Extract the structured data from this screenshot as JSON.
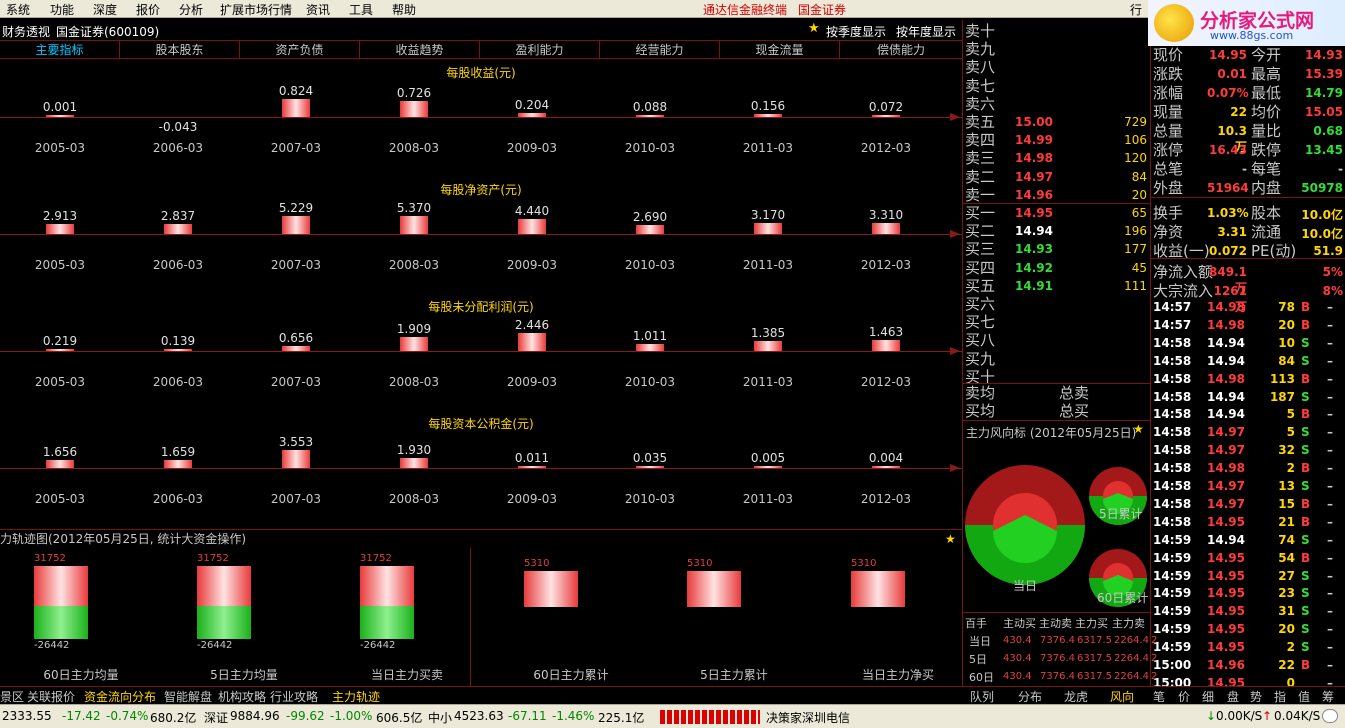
{
  "menubar": {
    "items": [
      "系统",
      "功能",
      "深度",
      "报价",
      "分析",
      "扩展市场行情",
      "资讯",
      "工具",
      "帮助"
    ],
    "links": [
      "通达信金融终端",
      "国金证券"
    ],
    "right_item": "行"
  },
  "watermark": {
    "line1": "分析家公式网",
    "line2": "www.88gs.com"
  },
  "titlebar": {
    "title": "财务透视",
    "stock": "国金证券(600109)",
    "opt_season": "按季度显示",
    "opt_year": "按年度显示"
  },
  "tabs": [
    "主要指标",
    "股本股东",
    "资产负债",
    "收益趋势",
    "盈利能力",
    "经营能力",
    "现金流量",
    "偿债能力"
  ],
  "years": [
    "2005-03",
    "2006-03",
    "2007-03",
    "2008-03",
    "2009-03",
    "2010-03",
    "2011-03",
    "2012-03"
  ],
  "sections": [
    {
      "title": "每股收益(元)",
      "values": [
        "0.001",
        "-0.043",
        "0.824",
        "0.726",
        "0.204",
        "0.088",
        "0.156",
        "0.072"
      ]
    },
    {
      "title": "每股净资产(元)",
      "values": [
        "2.913",
        "2.837",
        "5.229",
        "5.370",
        "4.440",
        "2.690",
        "3.170",
        "3.310"
      ]
    },
    {
      "title": "每股未分配利润(元)",
      "values": [
        "0.219",
        "0.139",
        "0.656",
        "1.909",
        "2.446",
        "1.011",
        "1.385",
        "1.463"
      ]
    },
    {
      "title": "每股资本公积金(元)",
      "values": [
        "1.656",
        "1.659",
        "3.553",
        "1.930",
        "0.011",
        "0.035",
        "0.005",
        "0.004"
      ]
    }
  ],
  "flow": {
    "title": "力轨迹图(2012年05月25日, 统计大资金操作)",
    "groups": [
      {
        "caption": "60日主力均量",
        "pos": "31752",
        "neg": "-26442",
        "pos_val": 31752,
        "neg_val": 26442
      },
      {
        "caption": "5日主力均量",
        "pos": "31752",
        "neg": "-26442",
        "pos_val": 31752,
        "neg_val": 26442
      },
      {
        "caption": "当日主力买卖",
        "pos": "31752",
        "neg": "-26442",
        "pos_val": 31752,
        "neg_val": 26442
      },
      {
        "caption": "60日主力累计",
        "pos": "5310",
        "neg": "",
        "pos_val": 5310,
        "neg_val": 0
      },
      {
        "caption": "5日主力累计",
        "pos": "5310",
        "neg": "",
        "pos_val": 5310,
        "neg_val": 0
      },
      {
        "caption": "当日主力净买",
        "pos": "5310",
        "neg": "",
        "pos_val": 5310,
        "neg_val": 0
      }
    ]
  },
  "orderbook": {
    "sell": [
      {
        "label": "卖十",
        "price": "",
        "vol": ""
      },
      {
        "label": "卖九",
        "price": "",
        "vol": ""
      },
      {
        "label": "卖八",
        "price": "",
        "vol": ""
      },
      {
        "label": "卖七",
        "price": "",
        "vol": ""
      },
      {
        "label": "卖六",
        "price": "",
        "vol": ""
      },
      {
        "label": "卖五",
        "price": "15.00",
        "vol": "729"
      },
      {
        "label": "卖四",
        "price": "14.99",
        "vol": "106"
      },
      {
        "label": "卖三",
        "price": "14.98",
        "vol": "120"
      },
      {
        "label": "卖二",
        "price": "14.97",
        "vol": "84"
      },
      {
        "label": "卖一",
        "price": "14.96",
        "vol": "20"
      }
    ],
    "buy": [
      {
        "label": "买一",
        "price": "14.95",
        "vol": "65",
        "color": "#ff3b3b"
      },
      {
        "label": "买二",
        "price": "14.94",
        "vol": "196",
        "color": "#ffffff"
      },
      {
        "label": "买三",
        "price": "14.93",
        "vol": "177",
        "color": "#33dd33"
      },
      {
        "label": "买四",
        "price": "14.92",
        "vol": "45",
        "color": "#33dd33"
      },
      {
        "label": "买五",
        "price": "14.91",
        "vol": "111",
        "color": "#33dd33"
      },
      {
        "label": "买六",
        "price": "",
        "vol": ""
      },
      {
        "label": "买七",
        "price": "",
        "vol": ""
      },
      {
        "label": "买八",
        "price": "",
        "vol": ""
      },
      {
        "label": "买九",
        "price": "",
        "vol": ""
      },
      {
        "label": "买十",
        "price": "",
        "vol": ""
      }
    ],
    "avg_sell": "卖均",
    "avg_buy": "买均",
    "total_sell": "总卖",
    "total_buy": "总买"
  },
  "quote": {
    "rows": [
      {
        "l1": "现价",
        "v1": "14.95",
        "c1": "#ff3b3b",
        "l2": "今开",
        "v2": "14.93",
        "c2": "#ff3b3b"
      },
      {
        "l1": "涨跌",
        "v1": "0.01",
        "c1": "#ff3b3b",
        "l2": "最高",
        "v2": "15.39",
        "c2": "#ff3b3b"
      },
      {
        "l1": "涨幅",
        "v1": "0.07%",
        "c1": "#ff3b3b",
        "l2": "最低",
        "v2": "14.79",
        "c2": "#33dd33"
      },
      {
        "l1": "现量",
        "v1": "22",
        "c1": "#ffd700",
        "l2": "均价",
        "v2": "15.05",
        "c2": "#ff3b3b"
      },
      {
        "l1": "总量",
        "v1": "10.3万",
        "c1": "#ffd700",
        "l2": "量比",
        "v2": "0.68",
        "c2": "#33dd33"
      },
      {
        "l1": "涨停",
        "v1": "16.43",
        "c1": "#ff3b3b",
        "l2": "跌停",
        "v2": "13.45",
        "c2": "#33dd33"
      },
      {
        "l1": "总笔",
        "v1": "-",
        "c1": "#c8c8c8",
        "l2": "每笔",
        "v2": "-",
        "c2": "#c8c8c8"
      },
      {
        "l1": "外盘",
        "v1": "51964",
        "c1": "#ff3b3b",
        "l2": "内盘",
        "v2": "50978",
        "c2": "#33dd33"
      },
      {
        "l1": "换手",
        "v1": "1.03%",
        "c1": "#ffd700",
        "l2": "股本",
        "v2": "10.0亿",
        "c2": "#ffd700"
      },
      {
        "l1": "净资",
        "v1": "3.31",
        "c1": "#ffd700",
        "l2": "流通",
        "v2": "10.0亿",
        "c2": "#ffd700"
      },
      {
        "l1": "收益(一)",
        "v1": "0.072",
        "c1": "#ffd700",
        "l2": "PE(动)",
        "v2": "51.9",
        "c2": "#ffd700"
      },
      {
        "l1": "净流入额",
        "v1": "849.1万",
        "c1": "#ff3b3b",
        "l2": "",
        "v2": "5%",
        "c2": "#ff3b3b"
      },
      {
        "l1": "大宗流入",
        "v1": "1261万",
        "c1": "#ff3b3b",
        "l2": "",
        "v2": "8%",
        "c2": "#ff3b3b"
      }
    ]
  },
  "ticks": [
    {
      "t": "14:57",
      "p": "14.98",
      "pc": "#ff3b3b",
      "v": "78",
      "s": "B"
    },
    {
      "t": "14:57",
      "p": "14.98",
      "pc": "#ff3b3b",
      "v": "20",
      "s": "B"
    },
    {
      "t": "14:58",
      "p": "14.94",
      "pc": "#ffffff",
      "v": "10",
      "s": "S"
    },
    {
      "t": "14:58",
      "p": "14.94",
      "pc": "#ffffff",
      "v": "84",
      "s": "S"
    },
    {
      "t": "14:58",
      "p": "14.98",
      "pc": "#ff3b3b",
      "v": "113",
      "s": "B"
    },
    {
      "t": "14:58",
      "p": "14.94",
      "pc": "#ffffff",
      "v": "187",
      "s": "S"
    },
    {
      "t": "14:58",
      "p": "14.94",
      "pc": "#ffffff",
      "v": "5",
      "s": "B"
    },
    {
      "t": "14:58",
      "p": "14.97",
      "pc": "#ff3b3b",
      "v": "5",
      "s": "S"
    },
    {
      "t": "14:58",
      "p": "14.97",
      "pc": "#ff3b3b",
      "v": "32",
      "s": "S"
    },
    {
      "t": "14:58",
      "p": "14.98",
      "pc": "#ff3b3b",
      "v": "2",
      "s": "B"
    },
    {
      "t": "14:58",
      "p": "14.97",
      "pc": "#ff3b3b",
      "v": "13",
      "s": "S"
    },
    {
      "t": "14:58",
      "p": "14.97",
      "pc": "#ff3b3b",
      "v": "15",
      "s": "B"
    },
    {
      "t": "14:58",
      "p": "14.95",
      "pc": "#ff3b3b",
      "v": "21",
      "s": "B"
    },
    {
      "t": "14:59",
      "p": "14.94",
      "pc": "#ffffff",
      "v": "74",
      "s": "S"
    },
    {
      "t": "14:59",
      "p": "14.95",
      "pc": "#ff3b3b",
      "v": "54",
      "s": "B"
    },
    {
      "t": "14:59",
      "p": "14.95",
      "pc": "#ff3b3b",
      "v": "27",
      "s": "S"
    },
    {
      "t": "14:59",
      "p": "14.95",
      "pc": "#ff3b3b",
      "v": "23",
      "s": "S"
    },
    {
      "t": "14:59",
      "p": "14.95",
      "pc": "#ff3b3b",
      "v": "31",
      "s": "S"
    },
    {
      "t": "14:59",
      "p": "14.95",
      "pc": "#ff3b3b",
      "v": "20",
      "s": "S"
    },
    {
      "t": "14:59",
      "p": "14.95",
      "pc": "#ff3b3b",
      "v": "2",
      "s": "S"
    },
    {
      "t": "15:00",
      "p": "14.96",
      "pc": "#ff3b3b",
      "v": "22",
      "s": "B"
    },
    {
      "t": "15:00",
      "p": "14.95",
      "pc": "#ff3b3b",
      "v": "0",
      "s": ""
    }
  ],
  "zl": {
    "title": "主力风向标 (2012年05月25日)",
    "today": "当日",
    "d5": "5日累计",
    "d60": "60日累计",
    "table_head": [
      "百手",
      "主动买",
      "主动卖",
      "主力买",
      "主力卖"
    ],
    "rows": [
      {
        "label": "当日",
        "vals": [
          "430.4",
          "7376.4",
          "6317.5",
          "2264.4",
          "2"
        ]
      },
      {
        "label": "5日",
        "vals": [
          "430.4",
          "7376.4",
          "6317.5",
          "2264.4",
          "2"
        ]
      },
      {
        "label": "60日",
        "vals": [
          "430.4",
          "7376.4",
          "6317.5",
          "2264.4",
          "2"
        ]
      }
    ]
  },
  "bottomtabs": {
    "left": [
      "景区",
      "关联报价",
      "资金流向分布",
      "智能解盘",
      "机构攻略",
      "行业攻略",
      "主力轨迹"
    ],
    "right": [
      "队列",
      "分布",
      "龙虎",
      "风向",
      "笔",
      "价",
      "细",
      "盘",
      "势",
      "指",
      "值",
      "筹"
    ]
  },
  "statusbar": {
    "sh": "2333.55",
    "sh_chg": "-17.42",
    "sh_pct": "-0.74%",
    "sh_amt": "680.2亿",
    "sz_label": "深证",
    "sz": "9884.96",
    "sz_chg": "-99.62",
    "sz_pct": "-1.00%",
    "sz_amt": "606.5亿",
    "zx_label": "中小",
    "zx": "4523.63",
    "zx_chg": "-67.11",
    "zx_pct": "-1.46%",
    "zx_amt": "225.1亿",
    "broker": "决策家深圳电信",
    "net1": "0.00K/S",
    "net2": "0.04K/S"
  }
}
